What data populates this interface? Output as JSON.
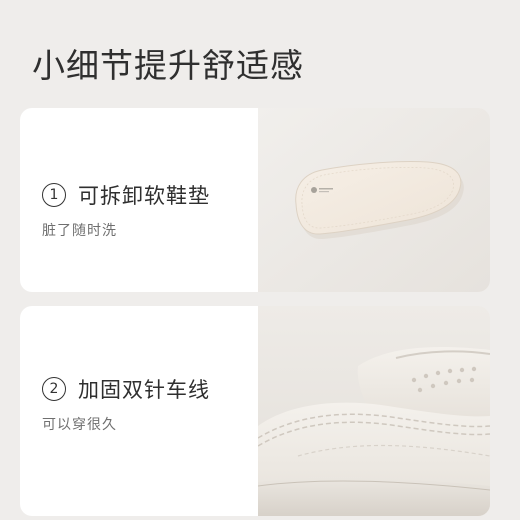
{
  "page_title": "小细节提升舒适感",
  "features": [
    {
      "number": "1",
      "title": "可拆卸软鞋垫",
      "subtitle": "脏了随时洗",
      "image_subject": "removable-insole"
    },
    {
      "number": "2",
      "title": "加固双针车线",
      "subtitle": "可以穿很久",
      "image_subject": "double-stitched-shoe-toe"
    }
  ],
  "colors": {
    "background": "#efedeb",
    "card": "#ffffff",
    "text_primary": "#2f2f2f",
    "text_secondary": "#6f6f6f"
  }
}
